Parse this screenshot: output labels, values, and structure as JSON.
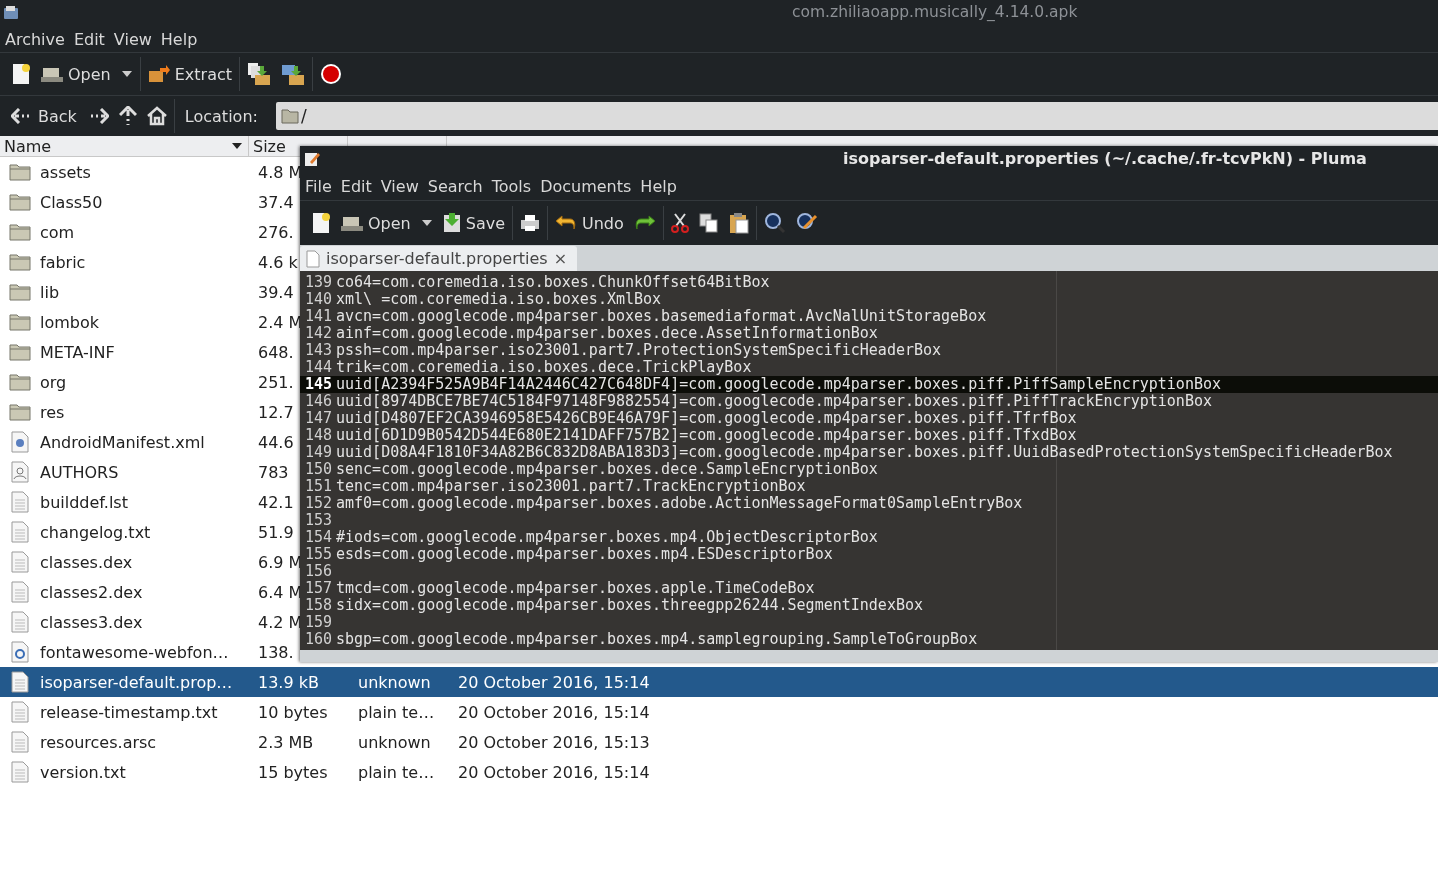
{
  "window": {
    "title": "com.zhiliaoapp.musically_4.14.0.apk"
  },
  "menu": [
    "Archive",
    "Edit",
    "View",
    "Help"
  ],
  "toolbar": {
    "open": "Open",
    "extract": "Extract"
  },
  "location_bar": {
    "back": "Back",
    "label": "Location:",
    "value": "/"
  },
  "table": {
    "columns": [
      {
        "label": "Name",
        "sorted": true
      },
      {
        "label": "Size",
        "sorted": false
      }
    ],
    "rows": [
      {
        "kind": "folder",
        "name": "assets",
        "size": "4.8 M",
        "selected": false
      },
      {
        "kind": "folder",
        "name": "Class50",
        "size": "37.4",
        "selected": false
      },
      {
        "kind": "folder",
        "name": "com",
        "size": "276.",
        "selected": false
      },
      {
        "kind": "folder",
        "name": "fabric",
        "size": "4.6 k",
        "selected": false
      },
      {
        "kind": "folder",
        "name": "lib",
        "size": "39.4",
        "selected": false
      },
      {
        "kind": "folder",
        "name": "lombok",
        "size": "2.4 M",
        "selected": false
      },
      {
        "kind": "folder",
        "name": "META-INF",
        "size": "648.",
        "selected": false
      },
      {
        "kind": "folder",
        "name": "org",
        "size": "251.",
        "selected": false
      },
      {
        "kind": "folder",
        "name": "res",
        "size": "12.7",
        "selected": false
      },
      {
        "kind": "xml",
        "name": "AndroidManifest.xml",
        "size": "44.6",
        "selected": false
      },
      {
        "kind": "person",
        "name": "AUTHORS",
        "size": "783",
        "selected": false
      },
      {
        "kind": "doc",
        "name": "builddef.lst",
        "size": "42.1",
        "selected": false
      },
      {
        "kind": "doc",
        "name": "changelog.txt",
        "size": "51.9",
        "selected": false
      },
      {
        "kind": "doc",
        "name": "classes.dex",
        "size": "6.9 M",
        "selected": false
      },
      {
        "kind": "doc",
        "name": "classes2.dex",
        "size": "6.4 M",
        "selected": false
      },
      {
        "kind": "doc",
        "name": "classes3.dex",
        "size": "4.2 M",
        "selected": false
      },
      {
        "kind": "font",
        "name": "fontawesome-webfon…",
        "size": "138.",
        "selected": false
      },
      {
        "kind": "doc",
        "name": "isoparser-default.prop…",
        "size": "13.9 kB",
        "type": "unknown",
        "date": "20 October 2016, 15:14",
        "selected": true
      },
      {
        "kind": "doc",
        "name": "release-timestamp.txt",
        "size": "10 bytes",
        "type": "plain te…",
        "date": "20 October 2016, 15:14",
        "selected": false
      },
      {
        "kind": "doc",
        "name": "resources.arsc",
        "size": "2.3 MB",
        "type": "unknown",
        "date": "20 October 2016, 15:13",
        "selected": false
      },
      {
        "kind": "doc",
        "name": "version.txt",
        "size": "15 bytes",
        "type": "plain te…",
        "date": "20 October 2016, 15:14",
        "selected": false
      }
    ]
  },
  "editor_window": {
    "title": "isoparser-default.properties (~/.cache/.fr-tcvPkN) - Pluma",
    "menu": [
      "File",
      "Edit",
      "View",
      "Search",
      "Tools",
      "Documents",
      "Help"
    ],
    "toolbar": {
      "open": "Open",
      "save": "Save",
      "undo": "Undo"
    },
    "tab": {
      "label": "isoparser-default.properties",
      "close": "×"
    },
    "lines": [
      {
        "num": "139",
        "text": "co64=com.coremedia.iso.boxes.ChunkOffset64BitBox",
        "current": false
      },
      {
        "num": "140",
        "text": "xml\\ =com.coremedia.iso.boxes.XmlBox",
        "current": false
      },
      {
        "num": "141",
        "text": "avcn=com.googlecode.mp4parser.boxes.basemediaformat.AvcNalUnitStorageBox",
        "current": false
      },
      {
        "num": "142",
        "text": "ainf=com.googlecode.mp4parser.boxes.dece.AssetInformationBox",
        "current": false
      },
      {
        "num": "143",
        "text": "pssh=com.mp4parser.iso23001.part7.ProtectionSystemSpecificHeaderBox",
        "current": false
      },
      {
        "num": "144",
        "text": "trik=com.coremedia.iso.boxes.dece.TrickPlayBox",
        "current": false
      },
      {
        "num": "145",
        "text": "uuid[A2394F525A9B4F14A2446C427C648DF4]=com.googlecode.mp4parser.boxes.piff.PiffSampleEncryptionBox",
        "current": true
      },
      {
        "num": "146",
        "text": "uuid[8974DBCE7BE74C5184F97148F9882554]=com.googlecode.mp4parser.boxes.piff.PiffTrackEncryptionBox",
        "current": false
      },
      {
        "num": "147",
        "text": "uuid[D4807EF2CA3946958E5426CB9E46A79F]=com.googlecode.mp4parser.boxes.piff.TfrfBox",
        "current": false
      },
      {
        "num": "148",
        "text": "uuid[6D1D9B0542D544E680E2141DAFF757B2]=com.googlecode.mp4parser.boxes.piff.TfxdBox",
        "current": false
      },
      {
        "num": "149",
        "text": "uuid[D08A4F1810F34A82B6C832D8ABA183D3]=com.googlecode.mp4parser.boxes.piff.UuidBasedProtectionSystemSpecificHeaderBox",
        "current": false
      },
      {
        "num": "150",
        "text": "senc=com.googlecode.mp4parser.boxes.dece.SampleEncryptionBox",
        "current": false
      },
      {
        "num": "151",
        "text": "tenc=com.mp4parser.iso23001.part7.TrackEncryptionBox",
        "current": false
      },
      {
        "num": "152",
        "text": "amf0=com.googlecode.mp4parser.boxes.adobe.ActionMessageFormat0SampleEntryBox",
        "current": false
      },
      {
        "num": "153",
        "current": false
      },
      {
        "num": "154",
        "text": "#iods=com.googlecode.mp4parser.boxes.mp4.ObjectDescriptorBox",
        "current": false
      },
      {
        "num": "155",
        "text": "esds=com.googlecode.mp4parser.boxes.mp4.ESDescriptorBox",
        "current": false
      },
      {
        "num": "156",
        "current": false
      },
      {
        "num": "157",
        "text": "tmcd=com.googlecode.mp4parser.boxes.apple.TimeCodeBox",
        "current": false
      },
      {
        "num": "158",
        "text": "sidx=com.googlecode.mp4parser.boxes.threegpp26244.SegmentIndexBox",
        "current": false
      },
      {
        "num": "159",
        "current": false
      },
      {
        "num": "160",
        "text": "sbgp=com.googlecode.mp4parser.boxes.mp4.samplegrouping.SampleToGroupBox",
        "current": false
      }
    ]
  }
}
